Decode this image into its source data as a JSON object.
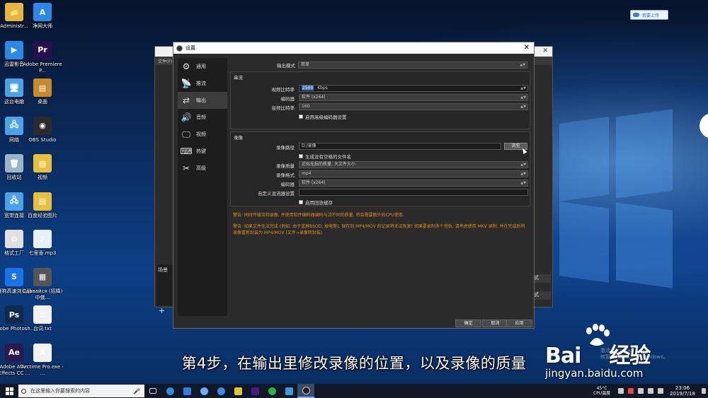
{
  "desktop": {
    "icons_col1": [
      {
        "label": "Administr...",
        "color": "#e8b340",
        "glyph": "📁"
      },
      {
        "label": "迅雷影音",
        "color": "#2d87e6",
        "glyph": "▶"
      },
      {
        "label": "这台电脑",
        "color": "#4aa3e8",
        "glyph": "🖥"
      },
      {
        "label": "网络",
        "color": "#4aa3e8",
        "glyph": "🖧"
      },
      {
        "label": "回收站",
        "color": "#9ab4c8",
        "glyph": "🗑"
      },
      {
        "label": "宽带连接",
        "color": "#4aa3e8",
        "glyph": "🖧"
      },
      {
        "label": "格式工厂",
        "color": "#e0e0e0",
        "glyph": "⚙"
      },
      {
        "label": "搜狗高速浏览器",
        "color": "#1a73e8",
        "glyph": "S"
      },
      {
        "label": "Adobe Photosh...",
        "color": "#0f2a4f",
        "glyph": "Ps"
      },
      {
        "label": "Adobe After Effects CC ...",
        "color": "#2a1a4f",
        "glyph": "Ae"
      }
    ],
    "icons_col2": [
      {
        "label": "净网大师",
        "color": "#2d87e6",
        "glyph": "A"
      },
      {
        "label": "Adobe Premiere P...",
        "color": "#2a0f4f",
        "glyph": "Pr"
      },
      {
        "label": "桌面",
        "color": "#c98a2a",
        "glyph": "▤"
      },
      {
        "label": "OBS Studio",
        "color": "#2a2a2a",
        "glyph": "◉"
      },
      {
        "label": "视频",
        "color": "#e8c040",
        "glyph": "▤"
      },
      {
        "label": "百度经验图片",
        "color": "#e8c040",
        "glyph": "▤"
      },
      {
        "label": "七里香.mp3",
        "color": "#e8f0f8",
        "glyph": "♪"
      },
      {
        "label": "Сдавайся (招降) 中俄...",
        "color": "#555",
        "glyph": "▦"
      },
      {
        "label": "台词.txt",
        "color": "#f2f2f2",
        "glyph": "≡"
      },
      {
        "label": "Arctime Pro.exe - ...",
        "color": "#f2f2f2",
        "glyph": "A"
      }
    ]
  },
  "upload_button": {
    "label": "我要上传"
  },
  "obs_main": {
    "menu": "文件(F)",
    "scene_label": "场景",
    "plus": "+",
    "right_stub_1": "式",
    "right_stub_2": "式"
  },
  "dialog": {
    "title": "设置",
    "close": "✕",
    "sidebar": [
      {
        "label": "通用",
        "icon": "gear-icon",
        "glyph": "⚙"
      },
      {
        "label": "推流",
        "icon": "antenna-icon",
        "glyph": "📡"
      },
      {
        "label": "输出",
        "icon": "output-icon",
        "glyph": "⇄",
        "active": true
      },
      {
        "label": "音频",
        "icon": "speaker-icon",
        "glyph": "🔊"
      },
      {
        "label": "视频",
        "icon": "monitor-icon",
        "glyph": "🖵"
      },
      {
        "label": "热键",
        "icon": "keyboard-icon",
        "glyph": "⌨"
      },
      {
        "label": "高级",
        "icon": "tools-icon",
        "glyph": "✂"
      }
    ],
    "output_mode": {
      "label": "输出模式",
      "value": "简单"
    },
    "streaming": {
      "title": "串流",
      "video_bitrate": {
        "label": "视频比特率",
        "value": "2500",
        "unit": "Kbps"
      },
      "encoder": {
        "label": "编码器",
        "value": "软件 (x264)"
      },
      "audio_bitrate": {
        "label": "音频比特率",
        "value": "160"
      },
      "advanced_cb": "启用高级编码器设置"
    },
    "recording": {
      "title": "录像",
      "path": {
        "label": "录像路径",
        "value": "D:/录像"
      },
      "browse": "浏览",
      "no_space_cb": "生成没有空格的文件名",
      "quality": {
        "label": "录像质量",
        "value": "近似无损的质量, 大文件大小"
      },
      "format": {
        "label": "录像格式",
        "value": "mp4"
      },
      "encoder": {
        "label": "编码器",
        "value": "软件 (x264)"
      },
      "muxer": {
        "label": "自定义混流器设置",
        "value": ""
      },
      "replay_cb": "启用回放缓存"
    },
    "warning_1": "警告: 同时传输流和录像, 并使用软件编码器编码与流不同的质量, 将会需要额外的CPU使用.",
    "warning_2": "警告: 如果文件无法完成 (例如: 由于蓝屏BSOD, 掉电等), 保存到 MP4/MOV 的记录将无法恢复! 如果要录制多个音轨, 请考虑使用 MKV 录制, 并在完成后将录像重新封装为 MP4/MOV (文件→录像转封装)",
    "buttons": {
      "ok": "确定",
      "cancel": "取消",
      "apply": "应用"
    }
  },
  "subtitle": "第4步，在输出里修改录像的位置，以及录像的质量",
  "watermark": {
    "logo_left": "Bai",
    "logo_right": "经验",
    "url": "jingyan.baidu.com",
    "activate_line1": "激活 Windows",
    "activate_line2": "转到\"设置\"以激活 Windows。"
  },
  "taskbar": {
    "search_placeholder": "在这里输入你要搜索的内容",
    "temp": "45°C",
    "temp_label": "CPU温度",
    "time": "23:06",
    "date": "2019/7/18"
  },
  "colors": {
    "warning": "#e28a1c",
    "selection": "#3b6fb6"
  }
}
